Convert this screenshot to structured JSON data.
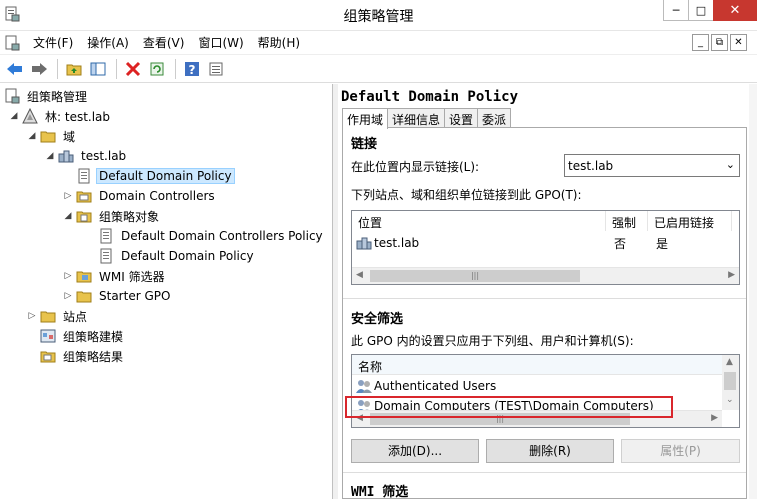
{
  "window": {
    "title": "组策略管理"
  },
  "menu": {
    "items": [
      "文件(F)",
      "操作(A)",
      "查看(V)",
      "窗口(W)",
      "帮助(H)"
    ]
  },
  "tree": {
    "root": "组策略管理",
    "forest": "林: test.lab",
    "domains": "域",
    "domain": "test.lab",
    "default_policy": "Default Domain Policy",
    "domain_controllers": "Domain Controllers",
    "gpo_container": "组策略对象",
    "gpo1": "Default Domain Controllers Policy",
    "gpo2": "Default Domain Policy",
    "wmi": "WMI 筛选器",
    "starter": "Starter GPO",
    "sites": "站点",
    "modeling": "组策略建模",
    "results": "组策略结果"
  },
  "detail": {
    "title": "Default Domain Policy",
    "tabs": [
      "作用域",
      "详细信息",
      "设置",
      "委派"
    ],
    "links_header": "链接",
    "show_links_label": "在此位置内显示链接(L):",
    "location_value": "test.lab",
    "linked_label": "下列站点、域和组织单位链接到此 GPO(T):",
    "links_columns": [
      "位置",
      "强制",
      "已启用链接"
    ],
    "links_rows": [
      {
        "location": "test.lab",
        "enforced": "否",
        "enabled": "是"
      }
    ],
    "security_header": "安全筛选",
    "security_label": "此 GPO 内的设置只应用于下列组、用户和计算机(S):",
    "security_column": "名称",
    "security_rows": [
      "Authenticated Users",
      "Domain Computers (TEST\\Domain Computers)"
    ],
    "add_button": "添加(D)...",
    "remove_button": "删除(R)",
    "properties_button": "属性(P)",
    "wmi_header": "WMI 筛选"
  },
  "colors": {
    "accent_highlight": "#d9262c",
    "selection": "#cce8ff",
    "close_button": "#c7372f"
  }
}
